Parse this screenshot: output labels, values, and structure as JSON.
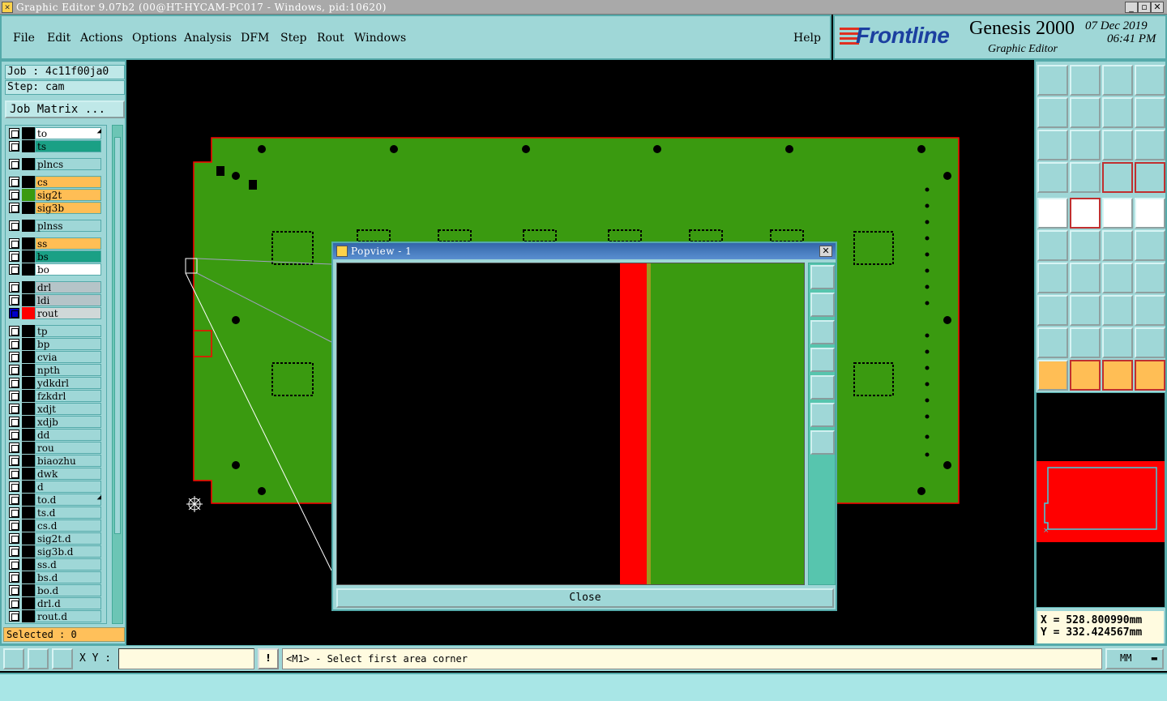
{
  "window": {
    "title": "Graphic Editor 9.07b2 (00@HT-HYCAM-PC017 - Windows, pid:10620)"
  },
  "menu": [
    {
      "label": "File"
    },
    {
      "label": "Edit"
    },
    {
      "label": "Actions"
    },
    {
      "label": "Options"
    },
    {
      "label": "Analysis"
    },
    {
      "label": "DFM"
    },
    {
      "label": "Step"
    },
    {
      "label": "Rout"
    },
    {
      "label": "Windows"
    },
    {
      "label": "Help"
    }
  ],
  "brand": {
    "logo": "Frontline",
    "product": "Genesis 2000",
    "subtitle": "Graphic Editor",
    "date": "07 Dec 2019",
    "time": "06:41 PM"
  },
  "job": {
    "job_label": "Job : 4c11f00ja0",
    "step_label": "Step: cam",
    "matrix_button": "Job Matrix ..."
  },
  "layers": [
    {
      "name": "to",
      "color": "#ffffff",
      "swatch": "#000000",
      "arrow": true
    },
    {
      "name": "ts",
      "color": "#1aa085",
      "swatch": "#000000"
    },
    {
      "name": "plncs",
      "color": "#9fd7d7",
      "swatch": "#000000"
    },
    {
      "name": "cs",
      "color": "#ffbe55",
      "swatch": "#000000"
    },
    {
      "name": "sig2t",
      "color": "#ffbe55",
      "swatch": "#3a9a10"
    },
    {
      "name": "sig3b",
      "color": "#ffbe55",
      "swatch": "#000000"
    },
    {
      "name": "plnss",
      "color": "#9fd7d7",
      "swatch": "#000000"
    },
    {
      "name": "ss",
      "color": "#ffbe55",
      "swatch": "#000000"
    },
    {
      "name": "bs",
      "color": "#1aa085",
      "swatch": "#000000"
    },
    {
      "name": "bo",
      "color": "#ffffff",
      "swatch": "#000000"
    },
    {
      "name": "drl",
      "color": "#b5c4c8",
      "swatch": "#000000"
    },
    {
      "name": "ldi",
      "color": "#b5c4c8",
      "swatch": "#000000"
    },
    {
      "name": "rout",
      "color": "#d0d8d8",
      "swatch": "#ff0000",
      "active": true
    },
    {
      "name": "tp",
      "color": "#9fd7d7",
      "swatch": "#000000"
    },
    {
      "name": "bp",
      "color": "#9fd7d7",
      "swatch": "#000000"
    },
    {
      "name": "cvia",
      "color": "#9fd7d7",
      "swatch": "#000000"
    },
    {
      "name": "npth",
      "color": "#9fd7d7",
      "swatch": "#000000"
    },
    {
      "name": "ydkdrl",
      "color": "#9fd7d7",
      "swatch": "#000000"
    },
    {
      "name": "fzkdrl",
      "color": "#9fd7d7",
      "swatch": "#000000"
    },
    {
      "name": "xdjt",
      "color": "#9fd7d7",
      "swatch": "#000000"
    },
    {
      "name": "xdjb",
      "color": "#9fd7d7",
      "swatch": "#000000"
    },
    {
      "name": "dd",
      "color": "#9fd7d7",
      "swatch": "#000000"
    },
    {
      "name": "rou",
      "color": "#9fd7d7",
      "swatch": "#000000"
    },
    {
      "name": "biaozhu",
      "color": "#9fd7d7",
      "swatch": "#000000"
    },
    {
      "name": "dwk",
      "color": "#9fd7d7",
      "swatch": "#000000"
    },
    {
      "name": "d",
      "color": "#9fd7d7",
      "swatch": "#000000"
    },
    {
      "name": "to.d",
      "color": "#9fd7d7",
      "swatch": "#000000",
      "arrow": true
    },
    {
      "name": "ts.d",
      "color": "#9fd7d7",
      "swatch": "#000000"
    },
    {
      "name": "cs.d",
      "color": "#9fd7d7",
      "swatch": "#000000"
    },
    {
      "name": "sig2t.d",
      "color": "#9fd7d7",
      "swatch": "#000000"
    },
    {
      "name": "sig3b.d",
      "color": "#9fd7d7",
      "swatch": "#000000"
    },
    {
      "name": "ss.d",
      "color": "#9fd7d7",
      "swatch": "#000000"
    },
    {
      "name": "bs.d",
      "color": "#9fd7d7",
      "swatch": "#000000"
    },
    {
      "name": "bo.d",
      "color": "#9fd7d7",
      "swatch": "#000000"
    },
    {
      "name": "drl.d",
      "color": "#9fd7d7",
      "swatch": "#000000"
    },
    {
      "name": "rout.d",
      "color": "#9fd7d7",
      "swatch": "#000000"
    }
  ],
  "selected": "Selected : 0",
  "popview": {
    "title": "Popview - 1",
    "close_label": "Close"
  },
  "coords": {
    "x": "X = 528.800990mm",
    "y": "Y = 332.424567mm"
  },
  "bottom": {
    "xy_label": "X Y :",
    "xy_value": "",
    "alert": "!",
    "prompt": "<M1> - Select first area corner",
    "units": "MM"
  },
  "colors": {
    "board": "#3a9a10",
    "outline": "#ff0000",
    "panel": "#9fd7d7",
    "highlight": "#ffbe55"
  }
}
